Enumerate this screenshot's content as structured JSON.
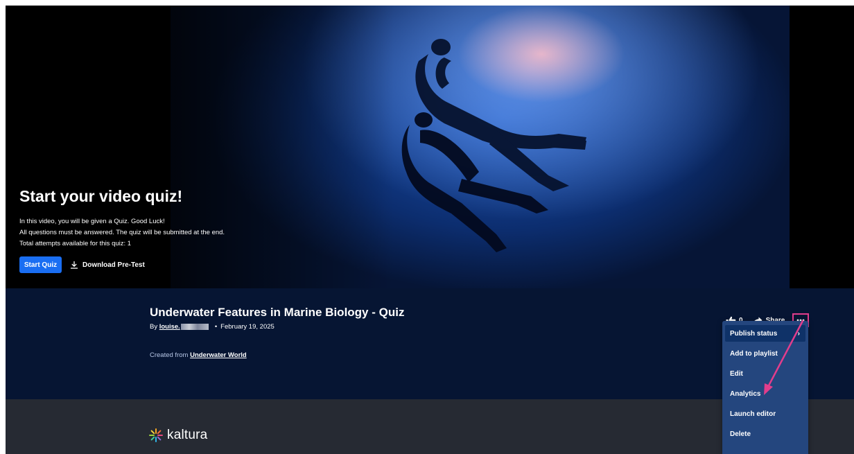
{
  "hero": {
    "title": "Start your video quiz!",
    "lines": [
      "In this video, you will be given a Quiz. Good Luck!",
      "All questions must be answered. The quiz will be submitted at the end.",
      "Total attempts available for this quiz: 1"
    ],
    "start_label": "Start Quiz",
    "download_label": "Download Pre-Test"
  },
  "entry": {
    "title": "Underwater Features in Marine Biology - Quiz",
    "by_prefix": "By",
    "author": "louise.",
    "date": "February 19, 2025",
    "created_prefix": "Created from",
    "created_link": "Underwater World"
  },
  "actions": {
    "like_count": "0",
    "share_label": "Share",
    "more_icon": "ellipsis-icon"
  },
  "menu": {
    "items": [
      {
        "label": "Publish status",
        "has_submenu": true,
        "active": true
      },
      {
        "label": "Add to playlist",
        "has_submenu": false
      },
      {
        "label": "Edit",
        "has_submenu": false
      },
      {
        "label": "Analytics",
        "has_submenu": false
      },
      {
        "label": "Launch editor",
        "has_submenu": false
      },
      {
        "label": "Delete",
        "has_submenu": false
      }
    ]
  },
  "footer": {
    "brand": "kaltura"
  },
  "colors": {
    "accent": "#1a6ef2",
    "highlight": "#e23d8c",
    "panel": "#061533",
    "menu": "#24467e",
    "footer": "#262a33"
  }
}
